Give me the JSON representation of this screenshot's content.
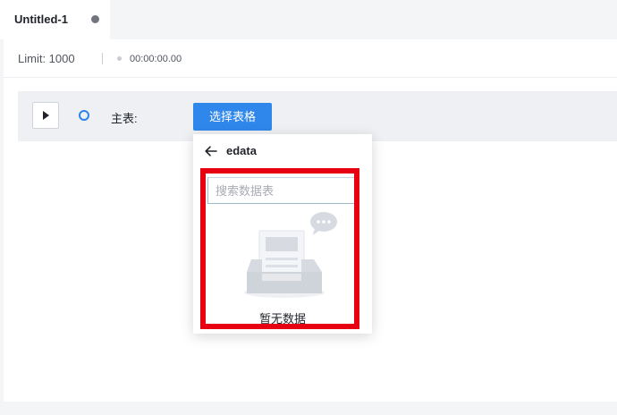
{
  "tab": {
    "title": "Untitled-1"
  },
  "status": {
    "limit_text": "Limit: 1000",
    "time": "00:00:00.00"
  },
  "query": {
    "main_table_label": "主表:",
    "select_table_button": "选择表格"
  },
  "dropdown": {
    "database_name": "edata",
    "search_placeholder": "搜索数据表",
    "search_value": "",
    "empty_text": "暂无数据"
  },
  "colors": {
    "accent": "#2f86eb",
    "highlight_border": "#e60012"
  },
  "icons": {
    "tab_status": "dot-icon",
    "run": "play-icon",
    "main_table": "circle-icon",
    "back": "arrow-left-icon",
    "empty": "empty-inbox-icon"
  }
}
